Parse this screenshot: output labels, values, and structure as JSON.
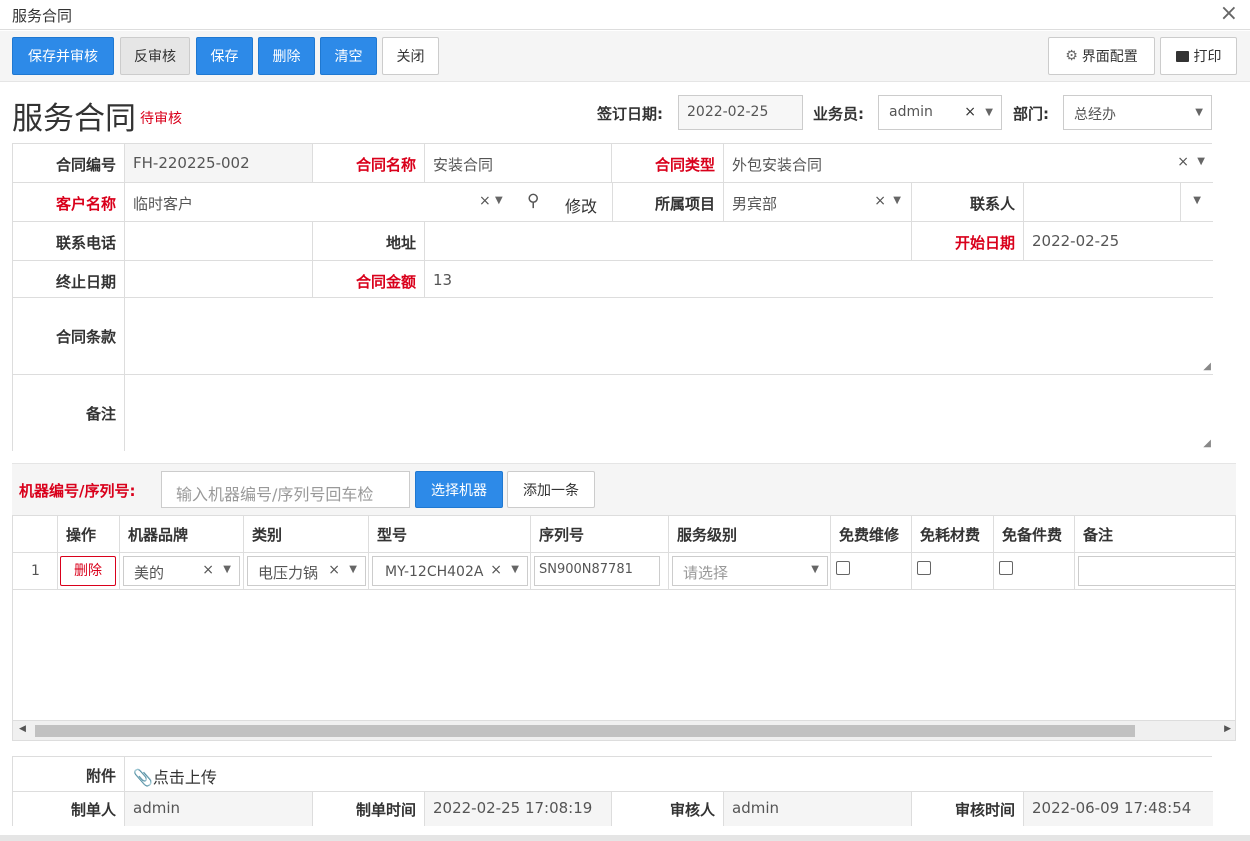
{
  "window": {
    "title": "服务合同",
    "close": "×"
  },
  "toolbar": {
    "save_audit": "保存并审核",
    "unaudit": "反审核",
    "save": "保存",
    "delete": "删除",
    "clear": "清空",
    "close": "关闭",
    "ui_config": "界面配置",
    "print": "打印"
  },
  "header": {
    "title": "服务合同",
    "status": "待审核",
    "sign_date_label": "签订日期:",
    "sign_date": "2022-02-25",
    "salesman_label": "业务员:",
    "salesman": "admin",
    "dept_label": "部门:",
    "dept": "总经办"
  },
  "form": {
    "contract_no_label": "合同编号",
    "contract_no": "FH-220225-002",
    "contract_name_label": "合同名称",
    "contract_name": "安装合同",
    "contract_type_label": "合同类型",
    "contract_type": "外包安装合同",
    "customer_label": "客户名称",
    "customer": "临时客户",
    "modify": "修改",
    "project_label": "所属项目",
    "project": "男宾部",
    "contact_label": "联系人",
    "contact": "",
    "phone_label": "联系电话",
    "phone": "",
    "address_label": "地址",
    "address": "",
    "start_label": "开始日期",
    "start": "2022-02-25",
    "end_label": "终止日期",
    "end": "",
    "amount_label": "合同金额",
    "amount": "13",
    "terms_label": "合同条款",
    "remark_label": "备注"
  },
  "machine": {
    "label": "机器编号/序列号:",
    "placeholder": "输入机器编号/序列号回车检",
    "select": "选择机器",
    "add": "添加一条"
  },
  "table": {
    "columns": [
      "操作",
      "机器品牌",
      "类别",
      "型号",
      "序列号",
      "服务级别",
      "免费维修",
      "免耗材费",
      "免备件费",
      "备注"
    ],
    "rows": [
      {
        "index": "1",
        "action": "删除",
        "brand": "美的",
        "category": "电压力锅",
        "model": "MY-12CH402A",
        "serial": "SN900N87781",
        "level_placeholder": "请选择"
      }
    ]
  },
  "footer": {
    "attachment_label": "附件",
    "upload": "点击上传",
    "creator_label": "制单人",
    "creator": "admin",
    "create_time_label": "制单时间",
    "create_time": "2022-02-25 17:08:19",
    "auditor_label": "审核人",
    "auditor": "admin",
    "audit_time_label": "审核时间",
    "audit_time": "2022-06-09 17:48:54"
  },
  "colors": {
    "primary": "#2d8ae8",
    "required": "#d9001b"
  }
}
